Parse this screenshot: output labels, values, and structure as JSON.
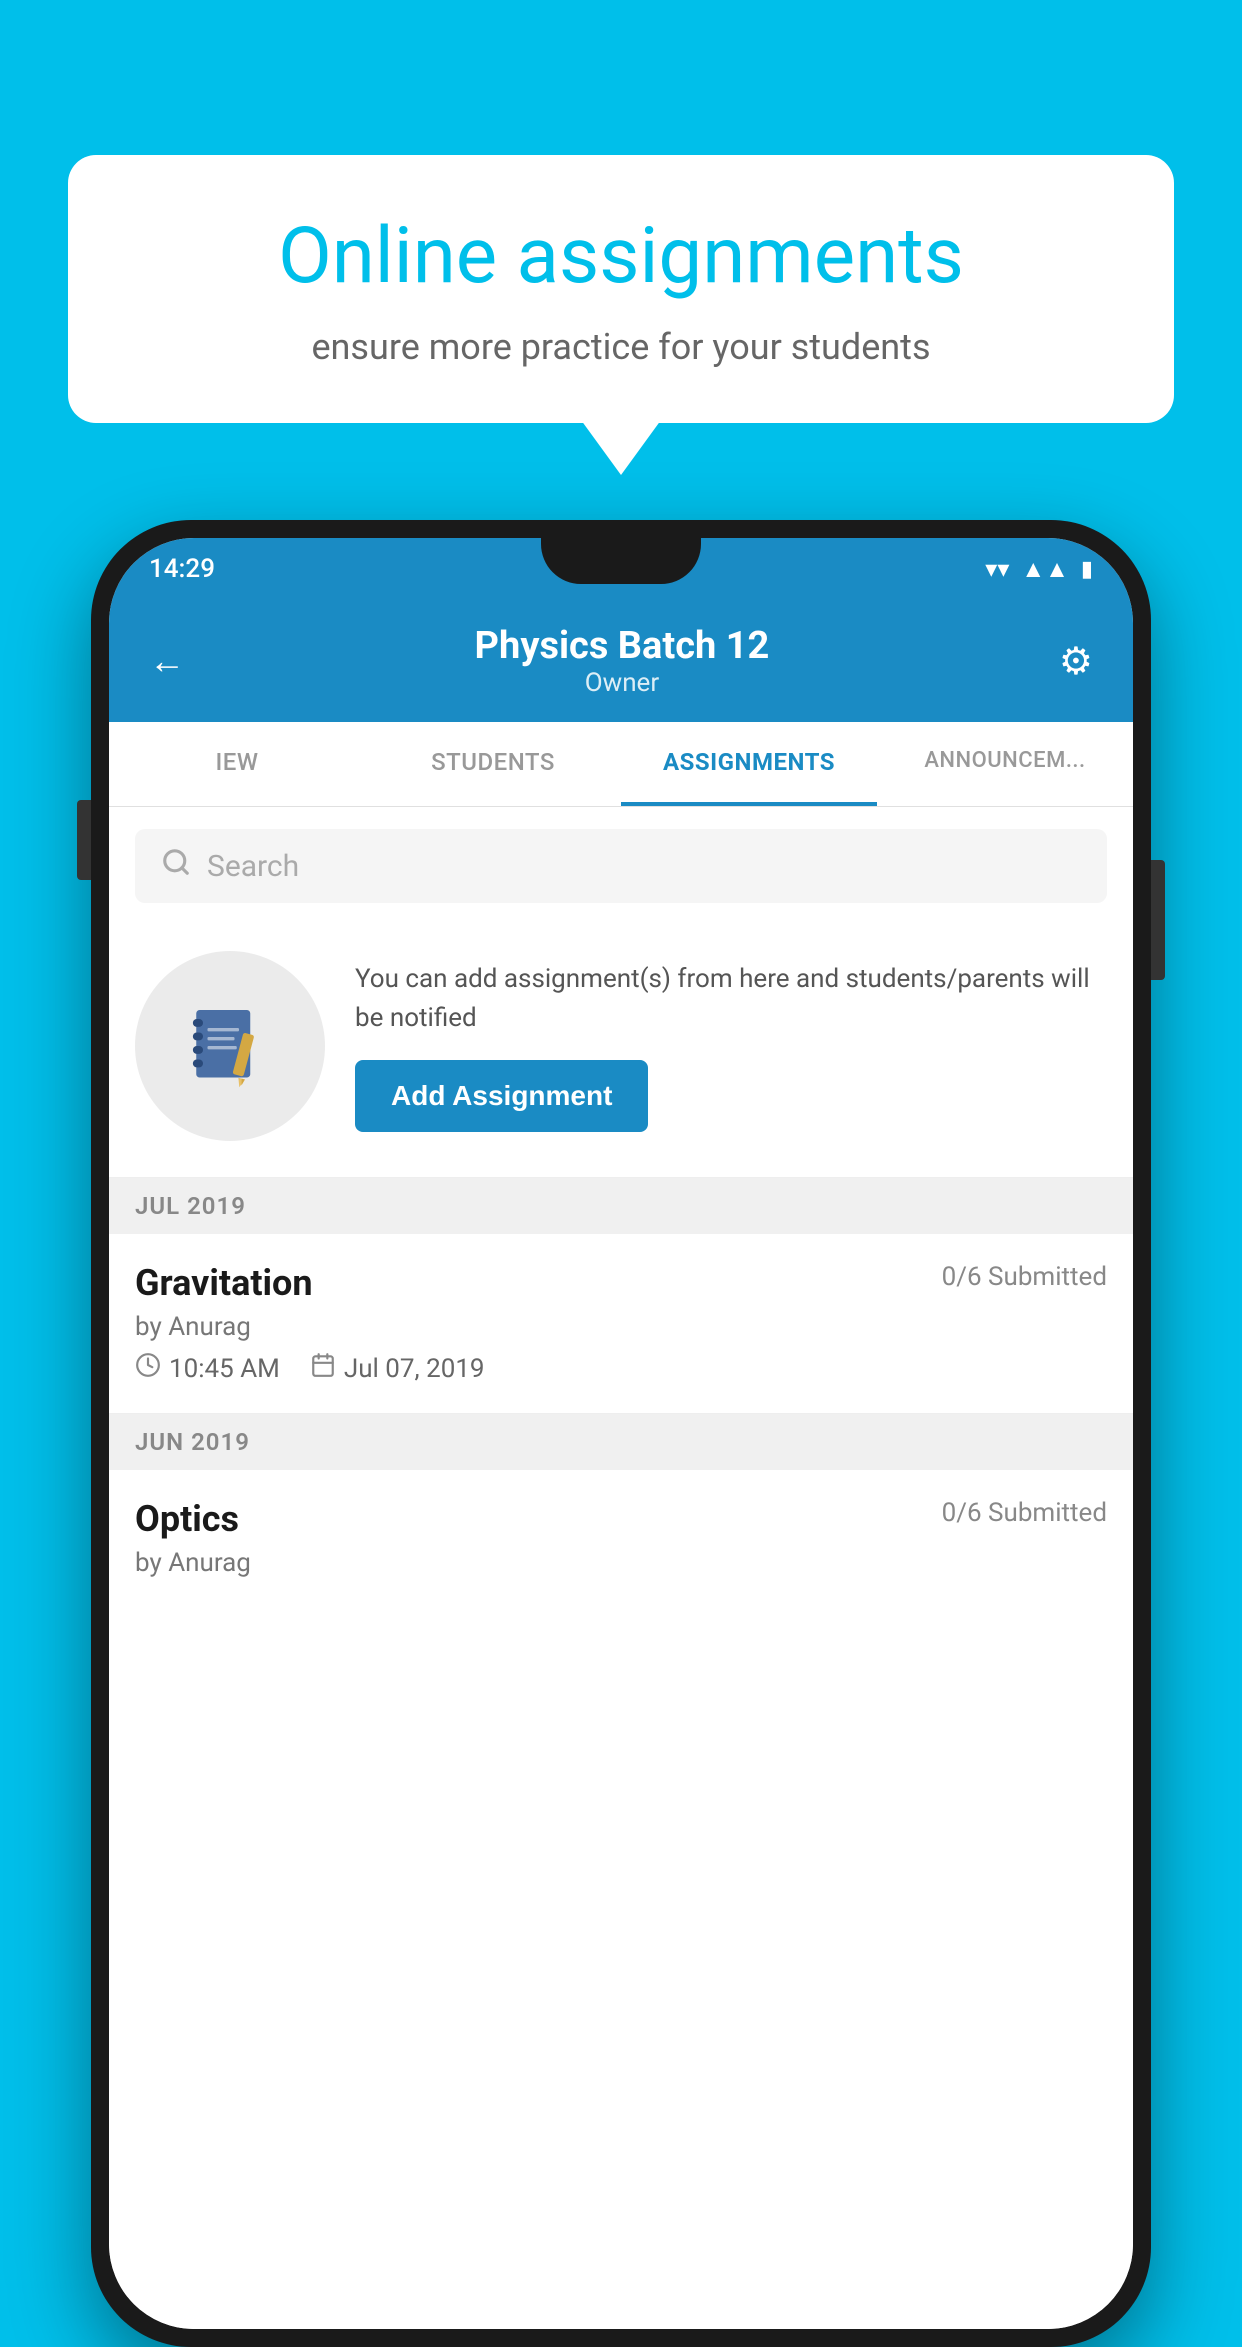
{
  "background_color": "#00BFEA",
  "speech_bubble": {
    "title": "Online assignments",
    "subtitle": "ensure more practice for your students"
  },
  "phone": {
    "status_bar": {
      "time": "14:29",
      "icons": [
        "wifi",
        "signal",
        "battery"
      ]
    },
    "header": {
      "title": "Physics Batch 12",
      "subtitle": "Owner",
      "back_label": "←",
      "settings_label": "⚙"
    },
    "tabs": [
      {
        "label": "IEW",
        "active": false
      },
      {
        "label": "STUDENTS",
        "active": false
      },
      {
        "label": "ASSIGNMENTS",
        "active": true
      },
      {
        "label": "ANNOUNCEM...",
        "active": false
      }
    ],
    "search": {
      "placeholder": "Search"
    },
    "promo": {
      "description": "You can add assignment(s) from here and students/parents will be notified",
      "button_label": "Add Assignment"
    },
    "sections": [
      {
        "month": "JUL 2019",
        "assignments": [
          {
            "name": "Gravitation",
            "submitted": "0/6 Submitted",
            "by": "by Anurag",
            "time": "10:45 AM",
            "date": "Jul 07, 2019"
          }
        ]
      },
      {
        "month": "JUN 2019",
        "assignments": [
          {
            "name": "Optics",
            "submitted": "0/6 Submitted",
            "by": "by Anurag",
            "time": "",
            "date": ""
          }
        ]
      }
    ]
  }
}
